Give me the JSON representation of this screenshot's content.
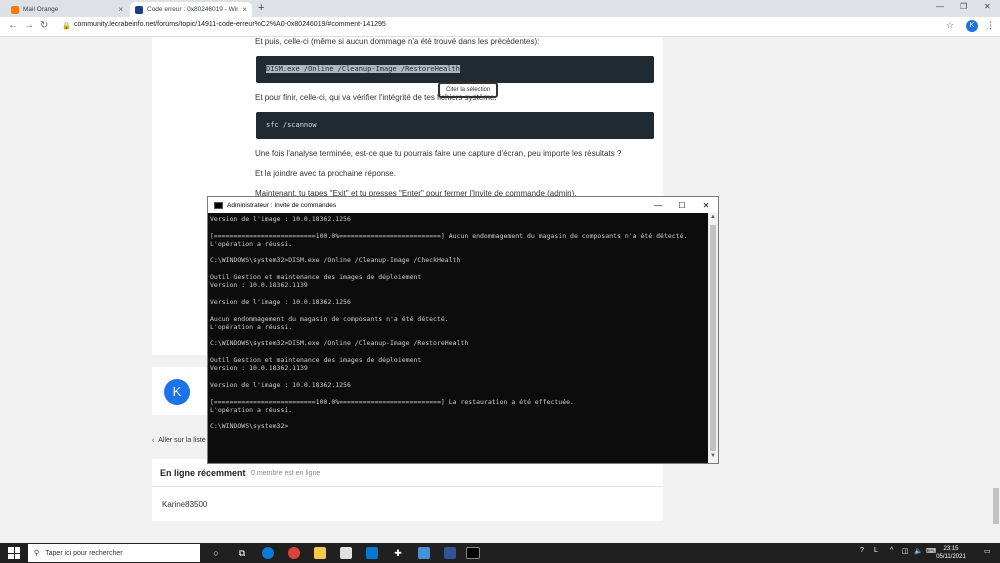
{
  "browser": {
    "tabs": [
      {
        "title": "Mail Orange",
        "color": "#ff7900"
      },
      {
        "title": "Code erreur : 0x80246019 - Windo",
        "color": "#1e3a8a"
      }
    ],
    "new_tab": "+",
    "url": "community.lecrabeinfo.net/forums/topic/14911-code-erreur%C2%A0-0x80246019/#comment-141295",
    "profile_initial": "K",
    "win_controls": [
      "—",
      "❐",
      "✕"
    ]
  },
  "post": {
    "p1": "Et puis, celle-ci (même si aucun dommage n'a été trouvé dans les précédentes):",
    "code1": "DISM.exe /Online /Cleanup-Image /RestoreHealth",
    "tooltip": "Citer la sélection",
    "p2": "Et pour finir, celle-ci, qui va vérifier l'intégrité de tes fichiers système.",
    "code2": "sfc /scannow",
    "p3": "Une fois l'analyse terminée, est-ce que tu pourrais faire une capture d'écran, peu importe les résultats ?",
    "p4": "Et la joindre avec ta prochaine réponse.",
    "p5": "Maintenant, tu tapes \"Exit\" et tu presses \"Enter\" pour fermer l'Invite de commande (admin)."
  },
  "reply_avatar": "K",
  "back_link": "Aller sur la liste",
  "online": {
    "title": "En ligne récemment",
    "count": "0 membre est en ligne",
    "member": "Karine83500"
  },
  "cmd": {
    "title": "Administrateur : Invite de commandes",
    "lines": [
      "Version de l'image : 10.0.18362.1256",
      "",
      "[==========================100.0%==========================] Aucun endommagement du magasin de composants n'a été détecté.",
      "L'opération a réussi.",
      "",
      "C:\\WINDOWS\\system32>DISM.exe /Online /Cleanup-Image /CheckHealth",
      "",
      "Outil Gestion et maintenance des images de déploiement",
      "Version : 10.0.18362.1139",
      "",
      "Version de l'image : 10.0.18362.1256",
      "",
      "Aucun endommagement du magasin de composants n'a été détecté.",
      "L'opération a réussi.",
      "",
      "C:\\WINDOWS\\system32>DISM.exe /Online /Cleanup-Image /RestoreHealth",
      "",
      "Outil Gestion et maintenance des images de déploiement",
      "Version : 10.0.18362.1139",
      "",
      "Version de l'image : 10.0.18362.1256",
      "",
      "[==========================100.0%==========================] La restauration a été effectuée.",
      "L'opération a réussi.",
      "",
      "C:\\WINDOWS\\system32>"
    ]
  },
  "taskbar": {
    "search_placeholder": "Taper ici pour rechercher",
    "time": "23:15",
    "date": "05/11/2021"
  }
}
